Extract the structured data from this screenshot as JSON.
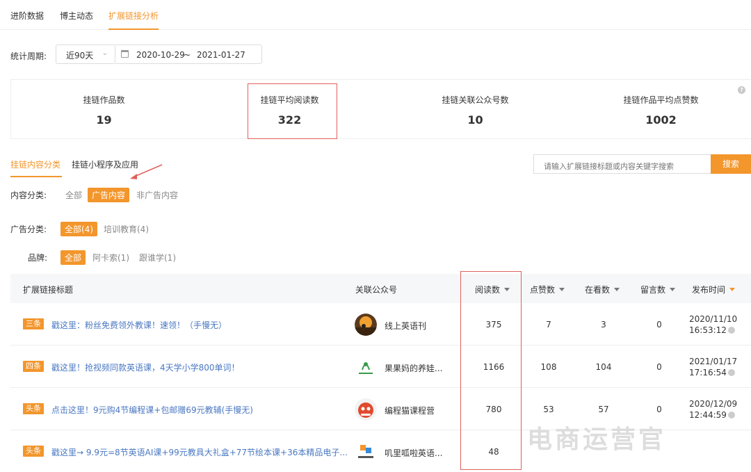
{
  "top_tabs": [
    {
      "label": "进阶数据"
    },
    {
      "label": "博主动态"
    },
    {
      "label": "扩展链接分析"
    }
  ],
  "period": {
    "label": "统计周期:",
    "selected": "近90天",
    "start": "2020-10-29",
    "sep": "~",
    "end": "2021-01-27"
  },
  "stats": [
    {
      "label": "挂链作品数",
      "value": "19"
    },
    {
      "label": "挂链平均阅读数",
      "value": "322"
    },
    {
      "label": "挂链关联公众号数",
      "value": "10"
    },
    {
      "label": "挂链作品平均点赞数",
      "value": "1002"
    }
  ],
  "sub_tabs": [
    {
      "label": "挂链内容分类"
    },
    {
      "label": "挂链小程序及应用"
    }
  ],
  "search": {
    "placeholder": "请输入扩展链接标题或内容关键字搜索",
    "button": "搜索"
  },
  "filters": {
    "content": {
      "label": "内容分类:",
      "options": [
        "全部",
        "广告内容",
        "非广告内容"
      ],
      "selected": "广告内容"
    },
    "ad": {
      "label": "广告分类:",
      "options": [
        "全部(4)",
        "培训教育(4)"
      ],
      "selected": "全部(4)"
    },
    "brand": {
      "label": "品牌:",
      "options": [
        "全部",
        "阿卡索(1)",
        "跟谁学(1)"
      ],
      "selected": "全部"
    }
  },
  "table": {
    "headers": {
      "title": "扩展链接标题",
      "account": "关联公众号",
      "reads": "阅读数",
      "likes": "点赞数",
      "viewing": "在看数",
      "comments": "留言数",
      "time": "发布时间"
    },
    "rows": [
      {
        "tag": "三条",
        "title": "戳这里：粉丝免费领外教课！速领！（手慢无）",
        "account": "线上英语刊",
        "reads": "375",
        "likes": "7",
        "viewing": "3",
        "comments": "0",
        "date": "2020/11/10",
        "clock": "16:53:12"
      },
      {
        "tag": "四条",
        "title": "戳这里！抢视频同款英语课，4天学小学800单词！",
        "account": "果果妈的养娃...",
        "reads": "1166",
        "likes": "108",
        "viewing": "104",
        "comments": "0",
        "date": "2021/01/17",
        "clock": "17:16:54"
      },
      {
        "tag": "头条",
        "title": "点击这里！9元购4节编程课+包邮赠69元教辅(手慢无)",
        "account": "编程猫课程营",
        "reads": "780",
        "likes": "53",
        "viewing": "57",
        "comments": "0",
        "date": "2020/12/09",
        "clock": "12:44:59"
      },
      {
        "tag": "头条",
        "title": "戳这里→ 9.9元=8节英语AI课+99元教具大礼盒+77节绘本课+36本精品电子...",
        "account": "叽里呱啦英语...",
        "reads": "48",
        "likes": "",
        "viewing": "",
        "comments": "",
        "date": "",
        "clock": ""
      }
    ]
  },
  "watermark": "电商运营官",
  "colors": {
    "accent": "#f3962c",
    "link": "#4a78c2",
    "highlight": "#e0605a"
  }
}
